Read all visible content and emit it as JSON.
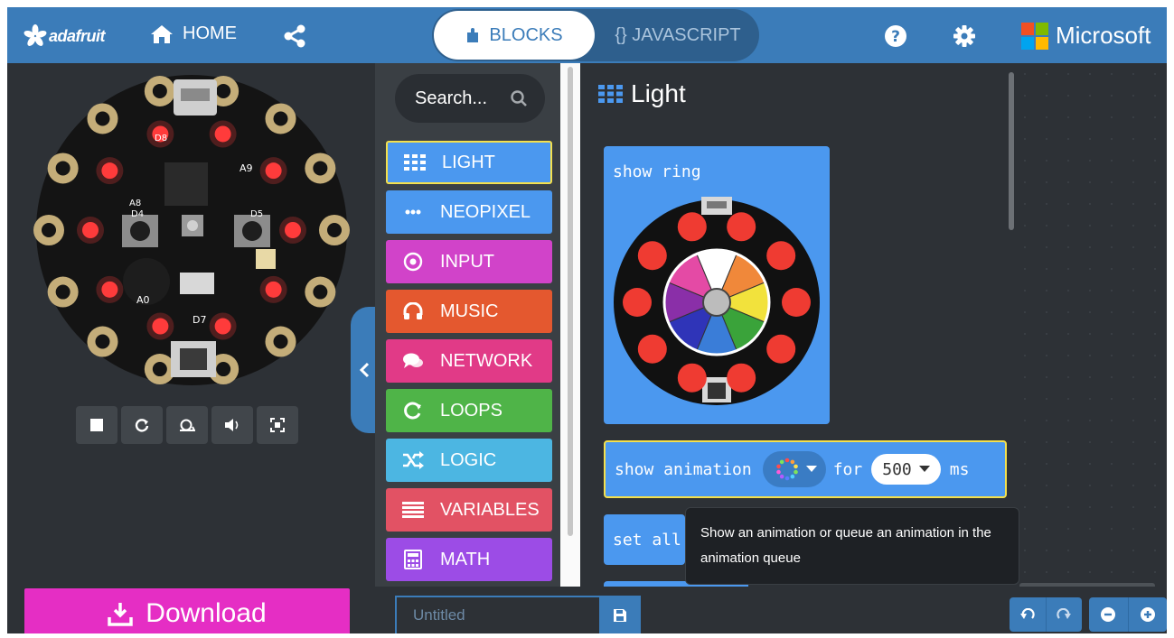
{
  "header": {
    "brand": "adafruit",
    "home_label": "HOME",
    "mode_blocks_label": "BLOCKS",
    "mode_js_label": "{} JAVASCRIPT",
    "partner_label": "Microsoft"
  },
  "simulator": {
    "controls": [
      "stop",
      "restart",
      "slow-mo",
      "mute",
      "fullscreen"
    ]
  },
  "toolbox": {
    "search_placeholder": "Search...",
    "categories": [
      {
        "label": "LIGHT",
        "color": "#4b98ef",
        "icon": "grid-icon"
      },
      {
        "label": "NEOPIXEL",
        "color": "#4b98ef",
        "icon": "dots-icon"
      },
      {
        "label": "INPUT",
        "color": "#d143c9",
        "icon": "target-icon"
      },
      {
        "label": "MUSIC",
        "color": "#e4582f",
        "icon": "headphones-icon"
      },
      {
        "label": "NETWORK",
        "color": "#e13a87",
        "icon": "chat-icon"
      },
      {
        "label": "LOOPS",
        "color": "#4fb448",
        "icon": "refresh-icon"
      },
      {
        "label": "LOGIC",
        "color": "#4cb6e2",
        "icon": "shuffle-icon"
      },
      {
        "label": "VARIABLES",
        "color": "#e25264",
        "icon": "lines-icon"
      },
      {
        "label": "MATH",
        "color": "#9c4ce6",
        "icon": "calculator-icon"
      }
    ]
  },
  "flyout": {
    "title": "Light",
    "blocks": {
      "show_ring": "show ring",
      "show_animation": "show animation",
      "for_label": "for",
      "ms_value": "500",
      "ms_unit": "ms",
      "set_all": "set all"
    },
    "tooltip": "Show an animation or queue an animation in the animation queue"
  },
  "footer": {
    "download_label": "Download",
    "project_name_placeholder": "Untitled"
  },
  "colors": {
    "brand_blue": "#3b7cb9",
    "download_pink": "#e52ec4",
    "highlight_yellow": "#f4e04d"
  }
}
